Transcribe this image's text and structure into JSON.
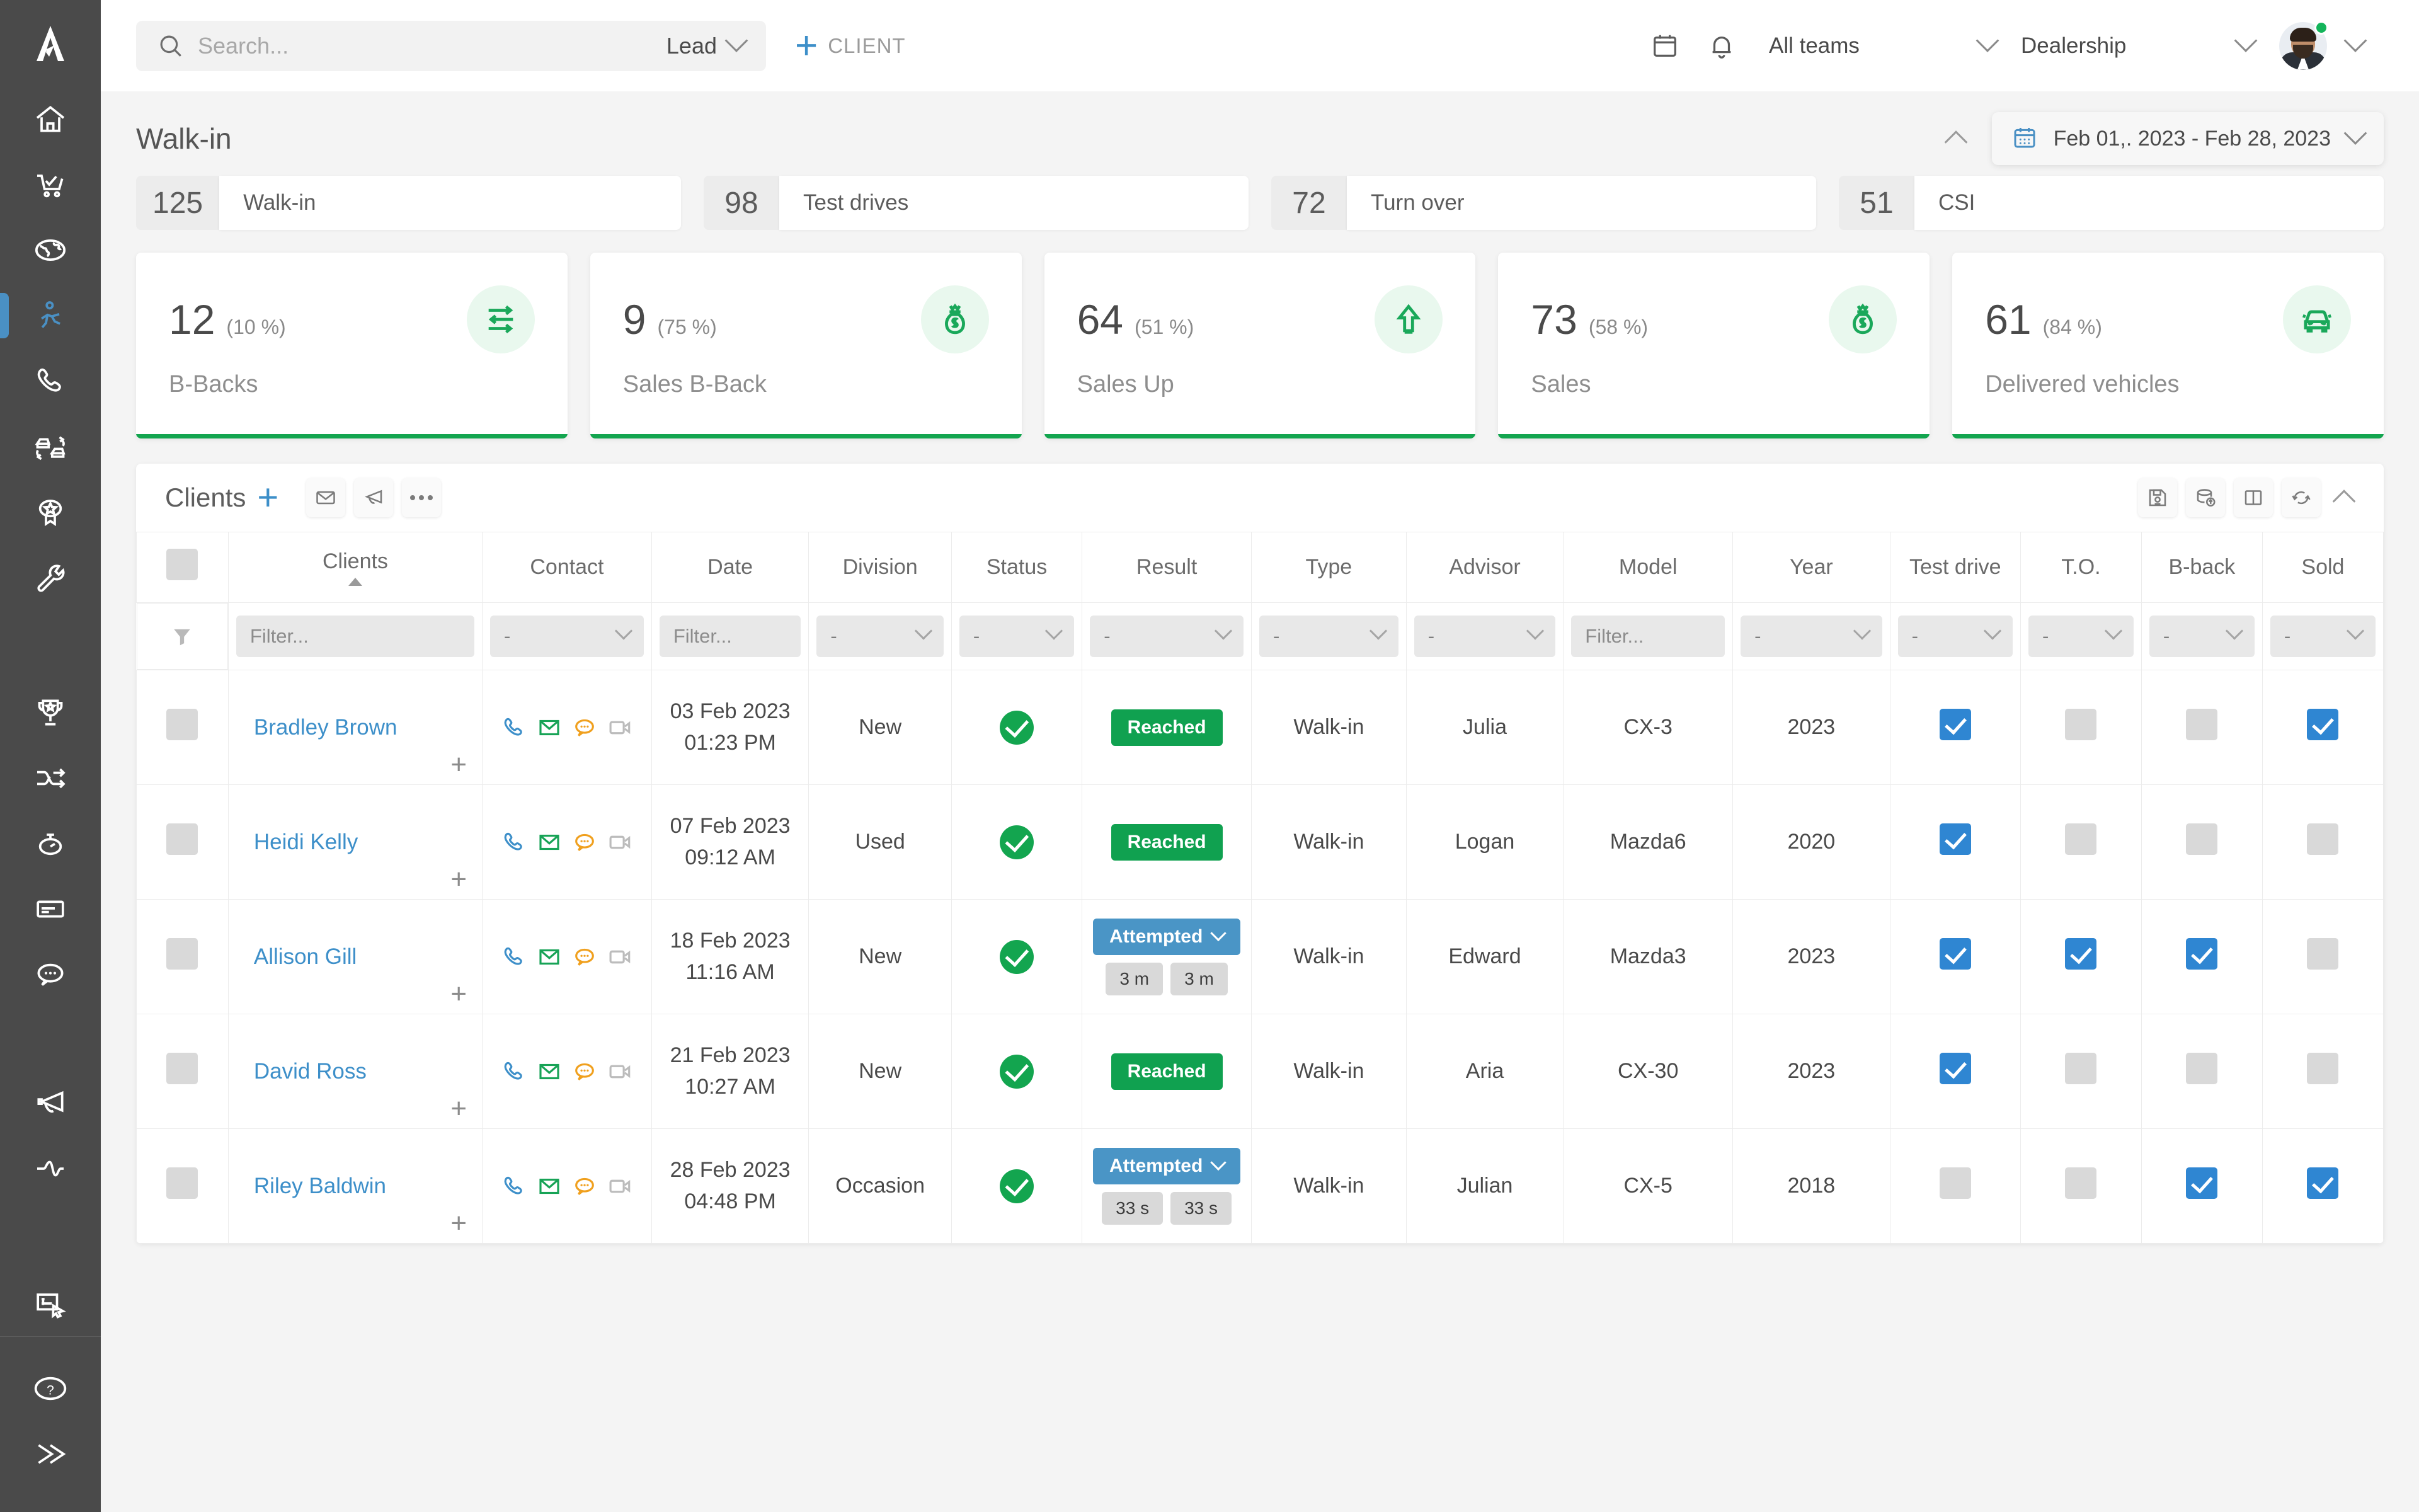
{
  "app": {
    "logo": "logo-a-icon"
  },
  "topbar": {
    "search": {
      "placeholder": "Search...",
      "value": "",
      "icon": "search-icon"
    },
    "lead_filter": {
      "label": "Lead",
      "icon": "chevron-down-icon"
    },
    "add_client": {
      "label": "CLIENT",
      "icon": "plus-icon"
    },
    "calendar_icon": "calendar-icon",
    "notifications_icon": "bell-icon",
    "teams_select": {
      "label": "All teams",
      "icon": "chevron-down-icon"
    },
    "dealership_select": {
      "label": "Dealership",
      "icon": "chevron-down-icon"
    },
    "avatar": {
      "name": "avatar",
      "status": "online"
    }
  },
  "sidebar": {
    "items": [
      {
        "name": "sidebar-item-home",
        "icon": "house-icon",
        "active": false
      },
      {
        "name": "sidebar-item-sales",
        "icon": "shopping-cart-check-icon",
        "active": false
      },
      {
        "name": "sidebar-item-web",
        "icon": "globe-icon",
        "active": false
      },
      {
        "name": "sidebar-item-walkin",
        "icon": "walking-person-icon",
        "active": true
      },
      {
        "name": "sidebar-item-calls",
        "icon": "phone-icon",
        "active": false
      },
      {
        "name": "sidebar-item-trade",
        "icon": "car-exchange-icon",
        "active": false
      },
      {
        "name": "sidebar-item-reviews",
        "icon": "badge-star-icon",
        "active": false
      },
      {
        "name": "sidebar-item-service",
        "icon": "wrench-icon",
        "active": false
      },
      {
        "name": "sidebar-item-leaderboard",
        "icon": "trophy-icon",
        "active": false
      },
      {
        "name": "sidebar-item-routing",
        "icon": "shuffle-icon",
        "active": false
      },
      {
        "name": "sidebar-item-timer",
        "icon": "stopwatch-icon",
        "active": false
      },
      {
        "name": "sidebar-item-cards",
        "icon": "card-icon",
        "active": false
      },
      {
        "name": "sidebar-item-chat",
        "icon": "chat-bubble-icon",
        "active": false
      },
      {
        "name": "sidebar-item-campaigns",
        "icon": "megaphone-icon",
        "active": false
      },
      {
        "name": "sidebar-item-activity",
        "icon": "pulse-wave-icon",
        "active": false
      },
      {
        "name": "sidebar-item-forms",
        "icon": "form-click-icon",
        "active": false
      }
    ],
    "bottom": [
      {
        "name": "sidebar-item-help",
        "icon": "question-circle-icon"
      },
      {
        "name": "sidebar-item-expand",
        "icon": "double-chevron-right-icon"
      }
    ]
  },
  "page": {
    "title": "Walk-in",
    "collapse_icon": "chevron-up-icon",
    "date_range": {
      "label": "Feb 01,. 2023 - Feb 28, 2023",
      "icon": "calendar-icon"
    }
  },
  "counters": [
    {
      "value": "125",
      "label": "Walk-in"
    },
    {
      "value": "98",
      "label": "Test drives"
    },
    {
      "value": "72",
      "label": "Turn over"
    },
    {
      "value": "51",
      "label": "CSI"
    }
  ],
  "cards": [
    {
      "value": "12",
      "percent": "(10 %)",
      "label": "B-Backs",
      "icon": "exchange-arrows-icon",
      "accent": "#13a54f"
    },
    {
      "value": "9",
      "percent": "(75 %)",
      "label": "Sales B-Back",
      "icon": "money-bag-icon",
      "accent": "#13a54f"
    },
    {
      "value": "64",
      "percent": "(51 %)",
      "label": "Sales Up",
      "icon": "arrow-up-icon",
      "accent": "#13a54f"
    },
    {
      "value": "73",
      "percent": "(58 %)",
      "label": "Sales",
      "icon": "money-bag-icon",
      "accent": "#13a54f"
    },
    {
      "value": "61",
      "percent": "(84 %)",
      "label": "Delivered vehicles",
      "icon": "car-front-icon",
      "accent": "#13a54f"
    }
  ],
  "clients_panel": {
    "title": "Clients",
    "add_icon": "plus-icon",
    "left_tools": [
      {
        "name": "email-button",
        "icon": "envelope-icon"
      },
      {
        "name": "broadcast-button",
        "icon": "megaphone-icon"
      },
      {
        "name": "more-options-button",
        "icon": "ellipsis-icon"
      }
    ],
    "right_tools": [
      {
        "name": "save-button",
        "icon": "floppy-disk-icon"
      },
      {
        "name": "export-database-button",
        "icon": "database-upload-icon"
      },
      {
        "name": "columns-layout-button",
        "icon": "split-columns-icon"
      },
      {
        "name": "refresh-button",
        "icon": "refresh-icon"
      },
      {
        "name": "collapse-panel-button",
        "icon": "chevron-up-icon"
      }
    ]
  },
  "table": {
    "columns": [
      {
        "key": "check",
        "label": ""
      },
      {
        "key": "clients",
        "label": "Clients",
        "sort": "asc"
      },
      {
        "key": "contact",
        "label": "Contact"
      },
      {
        "key": "date",
        "label": "Date"
      },
      {
        "key": "division",
        "label": "Division"
      },
      {
        "key": "status",
        "label": "Status"
      },
      {
        "key": "result",
        "label": "Result"
      },
      {
        "key": "type",
        "label": "Type"
      },
      {
        "key": "advisor",
        "label": "Advisor"
      },
      {
        "key": "model",
        "label": "Model"
      },
      {
        "key": "year",
        "label": "Year"
      },
      {
        "key": "testdrive",
        "label": "Test drive"
      },
      {
        "key": "to",
        "label": "T.O."
      },
      {
        "key": "bback",
        "label": "B-back"
      },
      {
        "key": "sold",
        "label": "Sold"
      }
    ],
    "filters": {
      "funnel_icon": "funnel-icon",
      "clients": {
        "type": "input",
        "placeholder": "Filter...",
        "value": ""
      },
      "contact": {
        "type": "select",
        "value": "-"
      },
      "date": {
        "type": "input",
        "placeholder": "Filter...",
        "value": ""
      },
      "division": {
        "type": "select",
        "value": "-"
      },
      "status": {
        "type": "select",
        "value": "-"
      },
      "result": {
        "type": "select",
        "value": "-"
      },
      "type": {
        "type": "select",
        "value": "-"
      },
      "advisor": {
        "type": "select",
        "value": "-"
      },
      "model": {
        "type": "input",
        "placeholder": "Filter...",
        "value": ""
      },
      "year": {
        "type": "select",
        "value": "-"
      },
      "testdrive": {
        "type": "select",
        "value": "-"
      },
      "to": {
        "type": "select",
        "value": "-"
      },
      "bback": {
        "type": "select",
        "value": "-"
      },
      "sold": {
        "type": "select",
        "value": "-"
      }
    },
    "rows": [
      {
        "selected": false,
        "name": "Bradley Brown",
        "contacts": [
          "phone-icon",
          "envelope-icon",
          "chat-bubble-icon",
          "video-camera-icon"
        ],
        "date": "03 Feb 2023",
        "time": "01:23 PM",
        "division": "New",
        "status": "ok",
        "result": {
          "label": "Reached",
          "kind": "reached",
          "timers": []
        },
        "type": "Walk-in",
        "advisor": "Julia",
        "model": "CX-3",
        "year": "2023",
        "testdrive": true,
        "to": false,
        "bback": false,
        "sold": true
      },
      {
        "selected": false,
        "name": "Heidi Kelly",
        "contacts": [
          "phone-icon",
          "envelope-icon",
          "chat-bubble-icon",
          "video-camera-icon"
        ],
        "date": "07 Feb 2023",
        "time": "09:12 AM",
        "division": "Used",
        "status": "ok",
        "result": {
          "label": "Reached",
          "kind": "reached",
          "timers": []
        },
        "type": "Walk-in",
        "advisor": "Logan",
        "model": "Mazda6",
        "year": "2020",
        "testdrive": true,
        "to": false,
        "bback": false,
        "sold": false
      },
      {
        "selected": false,
        "name": "Allison Gill",
        "contacts": [
          "phone-icon",
          "envelope-icon",
          "chat-bubble-icon",
          "video-camera-icon"
        ],
        "date": "18 Feb 2023",
        "time": "11:16 AM",
        "division": "New",
        "status": "ok",
        "result": {
          "label": "Attempted",
          "kind": "attempted",
          "timers": [
            "3 m",
            "3 m"
          ]
        },
        "type": "Walk-in",
        "advisor": "Edward",
        "model": "Mazda3",
        "year": "2023",
        "testdrive": true,
        "to": true,
        "bback": true,
        "sold": false
      },
      {
        "selected": false,
        "name": "David Ross",
        "contacts": [
          "phone-icon",
          "envelope-icon",
          "chat-bubble-icon",
          "video-camera-icon"
        ],
        "date": "21 Feb 2023",
        "time": "10:27 AM",
        "division": "New",
        "status": "ok",
        "result": {
          "label": "Reached",
          "kind": "reached",
          "timers": []
        },
        "type": "Walk-in",
        "advisor": "Aria",
        "model": "CX-30",
        "year": "2023",
        "testdrive": true,
        "to": false,
        "bback": false,
        "sold": false
      },
      {
        "selected": false,
        "name": "Riley Baldwin",
        "contacts": [
          "phone-icon",
          "envelope-icon",
          "chat-bubble-icon",
          "video-camera-icon"
        ],
        "date": "28 Feb 2023",
        "time": "04:48 PM",
        "division": "Occasion",
        "status": "ok",
        "result": {
          "label": "Attempted",
          "kind": "attempted",
          "timers": [
            "33 s",
            "33 s"
          ]
        },
        "type": "Walk-in",
        "advisor": "Julian",
        "model": "CX-5",
        "year": "2018",
        "testdrive": false,
        "to": false,
        "bback": true,
        "sold": true
      }
    ]
  }
}
